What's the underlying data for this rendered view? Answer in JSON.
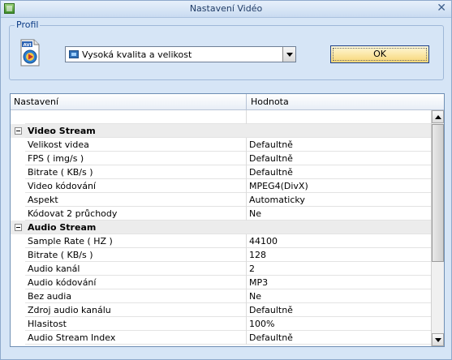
{
  "window": {
    "title": "Nastavení Vidéo"
  },
  "profile": {
    "group_label": "Profil",
    "icon": "avi-file-icon",
    "selected": "Vysoká kvalita a velikost",
    "ok_label": "OK"
  },
  "grid": {
    "col_setting": "Nastavení",
    "col_value": "Hodnota",
    "video_category": "Video Stream",
    "video_rows": [
      {
        "name": "Velikost videa",
        "value": "Defaultně"
      },
      {
        "name": "FPS ( img/s )",
        "value": "Defaultně"
      },
      {
        "name": "Bitrate ( KB/s )",
        "value": "Defaultně"
      },
      {
        "name": "Video kódování",
        "value": "MPEG4(DivX)"
      },
      {
        "name": "Aspekt",
        "value": "Automaticky"
      },
      {
        "name": "Kódovat 2 průchody",
        "value": "Ne"
      }
    ],
    "audio_category": "Audio Stream",
    "audio_rows": [
      {
        "name": "Sample Rate ( HZ )",
        "value": "44100"
      },
      {
        "name": "Bitrate ( KB/s )",
        "value": "128"
      },
      {
        "name": "Audio kanál",
        "value": "2"
      },
      {
        "name": "Audio kódování",
        "value": "MP3"
      },
      {
        "name": "Bez audia",
        "value": "Ne"
      },
      {
        "name": "Zdroj audio kanálu",
        "value": "Defaultně"
      },
      {
        "name": "Hlasitost",
        "value": "100%"
      },
      {
        "name": "Audio Stream Index",
        "value": "Defaultně"
      }
    ]
  }
}
